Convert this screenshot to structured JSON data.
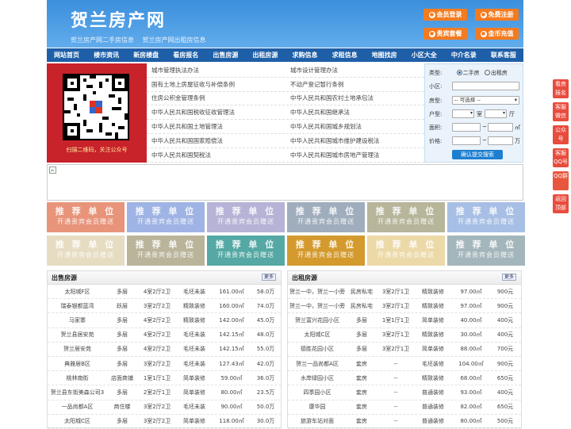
{
  "header": {
    "logo": "贺兰房产网",
    "subtitles": [
      "贺兰房产网二手房信息",
      "贺兰房产网出租房信息"
    ],
    "buttons": [
      {
        "label": "会员登录",
        "icon": "user-icon"
      },
      {
        "label": "免费注册",
        "icon": "register-icon"
      },
      {
        "label": "贵宾套餐",
        "icon": "vip-icon"
      },
      {
        "label": "金币充值",
        "icon": "coin-icon"
      }
    ]
  },
  "nav": [
    "网站首页",
    "楼市资讯",
    "新房楼盘",
    "看房报名",
    "出售房源",
    "出租房源",
    "求购信息",
    "求租信息",
    "地图找房",
    "小区大全",
    "中介名录",
    "联系客服"
  ],
  "qr": {
    "caption": "扫描二维码，关注公众号"
  },
  "links": [
    [
      "城市管理执法办法",
      "城市设计管理办法"
    ],
    [
      "国有土地上房屋征收与补偿条例",
      "不动产登记暂行条例"
    ],
    [
      "住房公积金管理条例",
      "中华人民共和国农村土地承包法"
    ],
    [
      "中华人民共和国税收征收管理法",
      "中华人民共和国继承法"
    ],
    [
      "中华人民共和国土地管理法",
      "中华人民共和国城乡规划法"
    ],
    [
      "中华人民共和国国家赔偿法",
      "中华人民共和国城市维护建设税法"
    ],
    [
      "中华人民共和国契税法",
      "中华人民共和国城市房地产管理法"
    ]
  ],
  "search": {
    "type_label": "类型:",
    "type_options": [
      "二手房",
      "出租房"
    ],
    "community_label": "小区:",
    "house_label": "房型:",
    "house_select": "-- 可选择 --",
    "layout_label": "户型:",
    "room_unit": "室",
    "hall_unit": "厅",
    "area_label": "面积:",
    "area_unit": "㎡",
    "price_label": "价格:",
    "price_unit": "万",
    "range_sep": "~",
    "submit": "确认提交搜索"
  },
  "ads": {
    "title": "推 荐 单 位",
    "subtitle": "开通贵宾会员赠送",
    "colors": [
      "#e8947a",
      "#9fb4e4",
      "#b6b3d6",
      "#9fadbd",
      "#b7b59a",
      "#a7bfe5",
      "#e6dcc2",
      "#b9b49a",
      "#55a8a3",
      "#d49a2e",
      "#ecd9a8",
      "#a3b6bb"
    ]
  },
  "sale": {
    "title": "出售房源",
    "more": "更多",
    "rows": [
      [
        "太阳城F区",
        "多层",
        "4室2厅2卫",
        "毛坯未装",
        "161.00㎡",
        "58.0万"
      ],
      [
        "瑞泰银都蓝湾",
        "跃层",
        "3室2厅2卫",
        "精致装修",
        "160.00㎡",
        "74.0万"
      ],
      [
        "马家寨",
        "多层",
        "4室2厅2卫",
        "精致装修",
        "142.00㎡",
        "45.0万"
      ],
      [
        "贺兰县居安苑",
        "多层",
        "4室2厅2卫",
        "毛坯未装",
        "142.15㎡",
        "48.0万"
      ],
      [
        "贺兰居安苑",
        "多层",
        "4室2厅2卫",
        "毛坯未装",
        "142.15㎡",
        "55.0万"
      ],
      [
        "典雅居B区",
        "多层",
        "3室2厅2卫",
        "毛坯未装",
        "127.43㎡",
        "42.0万"
      ],
      [
        "桃林南街",
        "店面商铺",
        "1室1厅1卫",
        "简单装修",
        "59.00㎡",
        "36.0万"
      ],
      [
        "贺兰县东街美森公司3",
        "多层",
        "2室2厅1卫",
        "简单装修",
        "80.00㎡",
        "23.5万"
      ],
      [
        "一品尚都A区",
        "商住楼",
        "3室2厅2卫",
        "毛坯未装",
        "90.00㎡",
        "50.0万"
      ],
      [
        "太阳城C区",
        "多层",
        "3室2厅2卫",
        "简单装修",
        "118.00㎡",
        "30.0万"
      ]
    ]
  },
  "rent": {
    "title": "出租房源",
    "more": "更多",
    "rows": [
      [
        "贺兰一中，贺兰一小旁",
        "民房私宅",
        "3室2厅1卫",
        "精致装修",
        "97.00㎡",
        "900元"
      ],
      [
        "贺兰一中，贺兰一小旁",
        "民房私宅",
        "3室2厅1卫",
        "精致装修",
        "97.00㎡",
        "900元"
      ],
      [
        "贺兰富兴花园小区",
        "多层",
        "1室1厅1卫",
        "简单装修",
        "40.00㎡",
        "400元"
      ],
      [
        "太阳城C区",
        "多层",
        "3室2厅1卫",
        "精致装修",
        "30.00㎡",
        "400元"
      ],
      [
        "德胜花园小区",
        "多层",
        "3室2厅1卫",
        "简单装修",
        "88.00㎡",
        "700元"
      ],
      [
        "贺兰一品尚都A区",
        "套房",
        "--",
        "毛坯装修",
        "104.00㎡",
        "900元"
      ],
      [
        "水岸绿园小区",
        "套房",
        "--",
        "精致装修",
        "68.00㎡",
        "650元"
      ],
      [
        "四季园小区",
        "套房",
        "--",
        "普通装修",
        "93.00㎡",
        "400元"
      ],
      [
        "康华园",
        "套房",
        "--",
        "普通装修",
        "82.00㎡",
        "650元"
      ],
      [
        "旅游车站对面",
        "套房",
        "--",
        "普通装修",
        "80.00㎡",
        "500元"
      ]
    ]
  },
  "float": [
    "看房报名",
    "客服微信",
    "公众号",
    "客服QQ号",
    "QQ群",
    "返回顶部"
  ]
}
